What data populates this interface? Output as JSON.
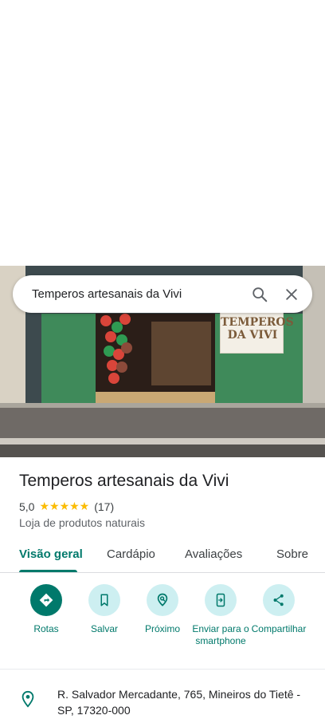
{
  "search": {
    "query": "Temperos artesanais da Vivi"
  },
  "photo": {
    "sign_text": "TEMPEROS DA VIVI"
  },
  "place": {
    "name": "Temperos artesanais da Vivi",
    "rating": "5,0",
    "stars_display": "★★★★★",
    "review_count": "(17)",
    "category": "Loja de produtos naturais"
  },
  "tabs": [
    {
      "label": "Visão geral"
    },
    {
      "label": "Cardápio"
    },
    {
      "label": "Avaliações"
    },
    {
      "label": "Sobre"
    }
  ],
  "actions": [
    {
      "label": "Rotas",
      "icon": "directions-icon"
    },
    {
      "label": "Salvar",
      "icon": "bookmark-icon"
    },
    {
      "label": "Próximo",
      "icon": "nearby-icon"
    },
    {
      "label": "Enviar para o smartphone",
      "icon": "send-to-phone-icon"
    },
    {
      "label": "Compartilhar",
      "icon": "share-icon"
    }
  ],
  "address": "R. Salvador Mercadante, 765, Mineiros do Tietê - SP, 17320-000",
  "colors": {
    "accent": "#00796b",
    "action_bg": "#cdeff1",
    "star": "#fbbc04"
  }
}
